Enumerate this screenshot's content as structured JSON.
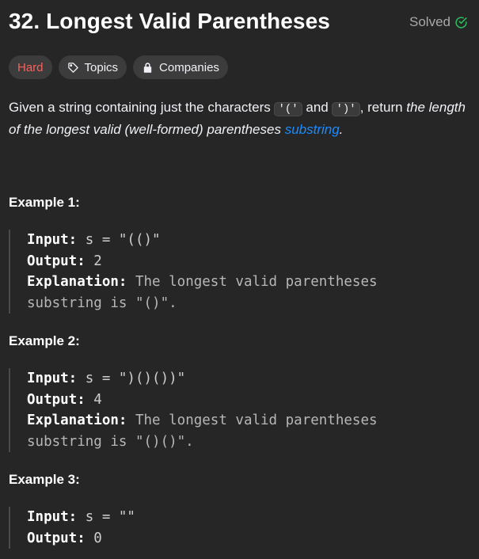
{
  "header": {
    "title": "32. Longest Valid Parentheses",
    "status": "Solved"
  },
  "tags": {
    "difficulty": "Hard",
    "topics": "Topics",
    "companies": "Companies"
  },
  "description": {
    "part1": "Given a string containing just the characters ",
    "code1": "'('",
    "part2": " and ",
    "code2": "')'",
    "part3": ", return ",
    "italic": "the length of the longest valid (well-formed) parentheses",
    "space": " ",
    "link": "substring",
    "end": "."
  },
  "examples": [
    {
      "title": "Example 1:",
      "input_label": "Input:",
      "input_value": " s = \"(()\"",
      "output_label": "Output:",
      "output_value": " 2",
      "explanation_label": "Explanation:",
      "explanation_line1": " The longest valid parentheses",
      "explanation_line2": "substring is \"()\"."
    },
    {
      "title": "Example 2:",
      "input_label": "Input:",
      "input_value": " s = \")()())\"",
      "output_label": "Output:",
      "output_value": " 4",
      "explanation_label": "Explanation:",
      "explanation_line1": " The longest valid parentheses",
      "explanation_line2": "substring is \"()()\"."
    },
    {
      "title": "Example 3:",
      "input_label": "Input:",
      "input_value": " s = \"\"",
      "output_label": "Output:",
      "output_value": " 0"
    }
  ],
  "colors": {
    "background": "#262626",
    "hard": "#f8615c",
    "solved_check": "#2cbb5d",
    "link": "#1a8cff"
  }
}
